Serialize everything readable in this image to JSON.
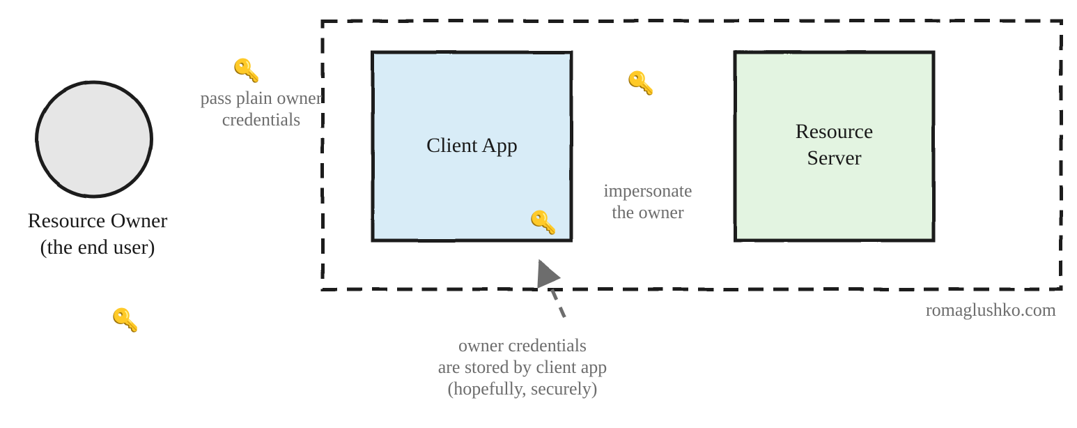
{
  "diagram": {
    "owner_label_l1": "Resource Owner",
    "owner_label_l2": "(the end user)",
    "client_label": "Client App",
    "server_label_l1": "Resource",
    "server_label_l2": "Server",
    "arrow1_label_l1": "pass plain owner",
    "arrow1_label_l2": "credentials",
    "arrow2_label_l1": "impersonate",
    "arrow2_label_l2": "the owner",
    "note_l1": "owner credentials",
    "note_l2": "are stored by client app",
    "note_l3": "(hopefully, securely)",
    "credit": "romaglushko.com",
    "icons": {
      "key_glyph": "🔑"
    }
  }
}
